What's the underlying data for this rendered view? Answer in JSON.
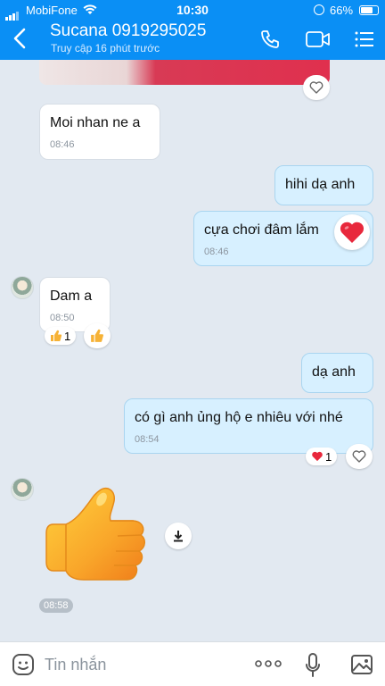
{
  "status_bar": {
    "carrier": "MobiFone",
    "time": "10:30",
    "battery": "66%"
  },
  "header": {
    "contact_name": "Sucana 0919295025",
    "last_seen": "Truy cập 16 phút trước"
  },
  "messages": [
    {
      "text": "Moi nhan ne a",
      "time": "08:46"
    },
    {
      "text": "hihi dạ anh"
    },
    {
      "text": "cựa chơi đâm lắm",
      "time": "08:46"
    },
    {
      "text": "Dam a",
      "time": "08:50",
      "reaction_count": "1"
    },
    {
      "text": "dạ anh"
    },
    {
      "text": "có gì anh ủng hộ e nhiêu với nhé",
      "time": "08:54",
      "reaction_count": "1"
    }
  ],
  "sticker": {
    "time": "08:58"
  },
  "input": {
    "placeholder": "Tin nhắn"
  },
  "colors": {
    "header": "#0a8ff5",
    "chat_bg": "#e2e9f1",
    "outgoing": "#d7f0ff",
    "incoming": "#ffffff",
    "heart": "#e8283c"
  },
  "icons": [
    "back-icon",
    "phone-icon",
    "video-icon",
    "menu-icon",
    "heart-icon",
    "thumbs-up-icon",
    "download-icon",
    "sticker-icon",
    "more-icon",
    "mic-icon",
    "image-icon"
  ]
}
